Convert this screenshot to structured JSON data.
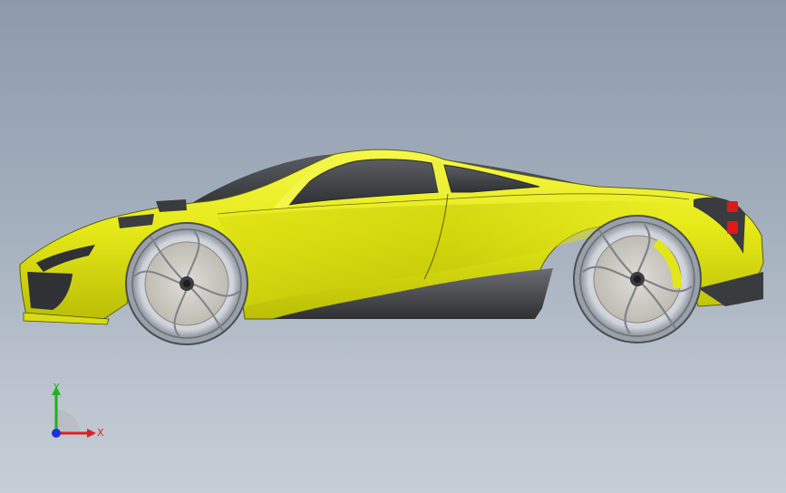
{
  "viewport": {
    "model": "sports-car-side-view",
    "body_color": "#e8ec1c",
    "background_top": "#8e9aab",
    "background_bottom": "#c6cdd6"
  },
  "triad": {
    "x_label": "X",
    "y_label": "Y",
    "x_color": "#e02020",
    "y_color": "#20b020",
    "z_color": "#2030e0"
  }
}
